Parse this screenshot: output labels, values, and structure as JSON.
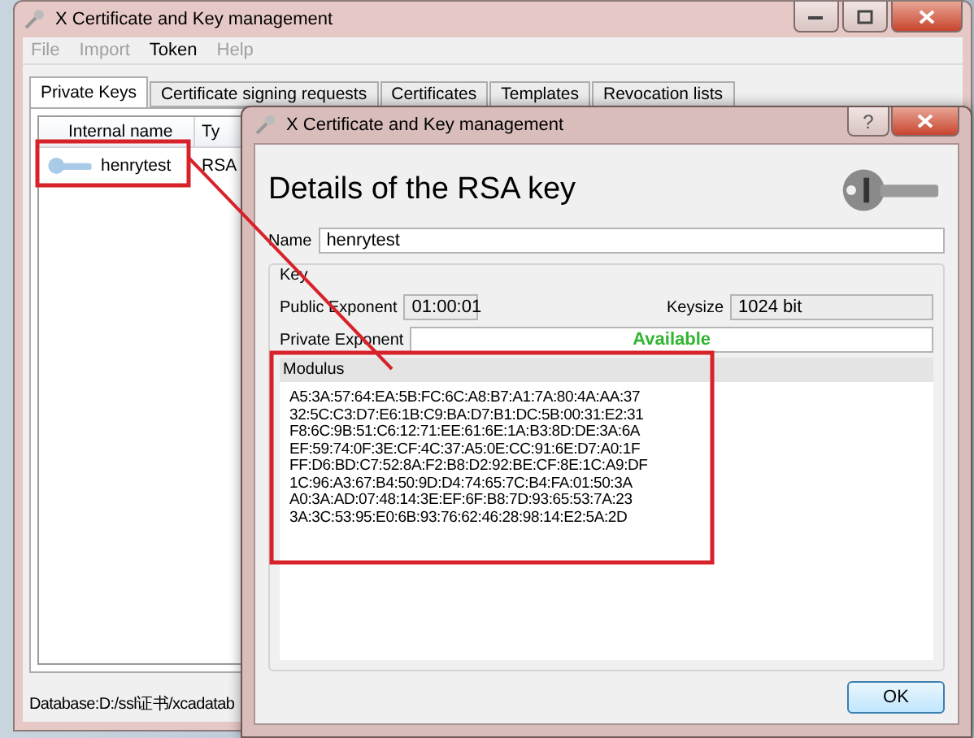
{
  "main_window": {
    "title": "X Certificate and Key management",
    "menu": [
      {
        "label": "File",
        "disabled": true
      },
      {
        "label": "Import",
        "disabled": true
      },
      {
        "label": "Token",
        "disabled": false
      },
      {
        "label": "Help",
        "disabled": true
      }
    ],
    "tabs": [
      {
        "label": "Private Keys",
        "selected": true
      },
      {
        "label": "Certificate signing requests",
        "selected": false
      },
      {
        "label": "Certificates",
        "selected": false
      },
      {
        "label": "Templates",
        "selected": false
      },
      {
        "label": "Revocation lists",
        "selected": false
      }
    ],
    "table": {
      "columns": [
        "Internal name",
        "Ty"
      ],
      "rows": [
        {
          "cells": [
            "henrytest",
            "RSA"
          ],
          "selected": false
        }
      ]
    },
    "status_bar": "Database:D:/ssl证书/xcadatab"
  },
  "dialog": {
    "title": "X Certificate and Key management",
    "help_button": "?",
    "heading": "Details of the RSA key",
    "name_label": "Name",
    "name_value": "henrytest",
    "group_title": "Key",
    "public_exponent_label": "Public Exponent",
    "public_exponent": "01:00:01",
    "keysize_label": "Keysize",
    "keysize": "1024 bit",
    "private_exponent_label": "Private Exponent",
    "private_exponent": "Available",
    "modulus_label": "Modulus",
    "modulus_lines": [
      "A5:3A:57:64:EA:5B:FC:6C:A8:B7:A1:7A:80:4A:AA:37",
      "32:5C:C3:D7:E6:1B:C9:BA:D7:B1:DC:5B:00:31:E2:31",
      "F8:6C:9B:51:C6:12:71:EE:61:6E:1A:B3:8D:DE:3A:6A",
      "EF:59:74:0F:3E:CF:4C:37:A5:0E:CC:91:6E:D7:A0:1F",
      "FF:D6:BD:C7:52:8A:F2:B8:D2:92:BE:CF:8E:1C:A9:DF",
      "1C:96:A3:67:B4:50:9D:D4:74:65:7C:B4:FA:01:50:3A",
      "A0:3A:AD:07:48:14:3E:EF:6F:B8:7D:93:65:53:7A:23",
      "3A:3C:53:95:E0:6B:93:76:62:46:28:98:14:E2:5A:2D"
    ],
    "ok_button": "OK"
  }
}
